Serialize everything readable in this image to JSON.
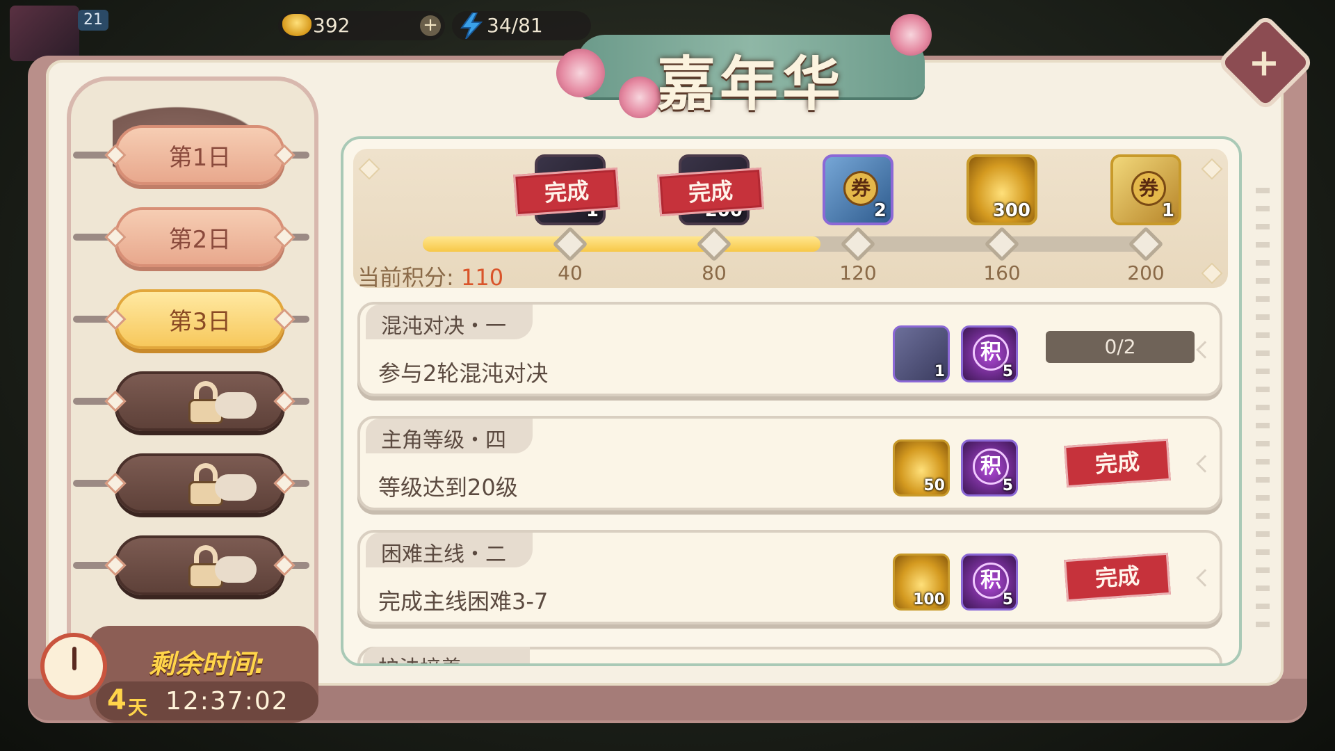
{
  "topbar": {
    "level": "21",
    "gold": "392",
    "energy": "34/81"
  },
  "title": "嘉年华",
  "days": [
    {
      "label": "第1日",
      "state": "normal"
    },
    {
      "label": "第2日",
      "state": "normal"
    },
    {
      "label": "第3日",
      "state": "active"
    },
    {
      "label": "",
      "state": "locked"
    },
    {
      "label": "",
      "state": "locked"
    },
    {
      "label": "",
      "state": "locked"
    }
  ],
  "timer": {
    "label": "剩余时间:",
    "days": "4",
    "unit": "天",
    "time": "12:37:02"
  },
  "rewards": {
    "score_label": "当前积分:",
    "score_value": "110",
    "score_fraction": 0.55,
    "milestones": [
      {
        "points": "40",
        "count": "1",
        "kind": "dark",
        "done": true,
        "done_label": "完成"
      },
      {
        "points": "80",
        "count": "200",
        "kind": "dark",
        "done": true,
        "done_label": "完成"
      },
      {
        "points": "120",
        "count": "2",
        "kind": "blue-ticket",
        "done": false,
        "icon_char": "券"
      },
      {
        "points": "160",
        "count": "300",
        "kind": "gold",
        "done": false
      },
      {
        "points": "200",
        "count": "1",
        "kind": "gold-ticket",
        "done": false,
        "icon_char": "券"
      }
    ]
  },
  "tasks": [
    {
      "title": "混沌对决・一",
      "desc": "参与2轮混沌对决",
      "rewards": [
        {
          "kind": "card",
          "count": "1"
        },
        {
          "kind": "point",
          "char": "积",
          "count": "5"
        }
      ],
      "progress": "0/2",
      "done": false
    },
    {
      "title": "主角等级・四",
      "desc": "等级达到20级",
      "rewards": [
        {
          "kind": "gold",
          "count": "50"
        },
        {
          "kind": "point",
          "char": "积",
          "count": "5"
        }
      ],
      "done": true,
      "done_label": "完成"
    },
    {
      "title": "困难主线・二",
      "desc": "完成主线困难3-7",
      "rewards": [
        {
          "kind": "gold",
          "count": "100"
        },
        {
          "kind": "point",
          "char": "积",
          "count": "5"
        }
      ],
      "done": true,
      "done_label": "完成"
    }
  ],
  "partial_task_title": "护法培养"
}
